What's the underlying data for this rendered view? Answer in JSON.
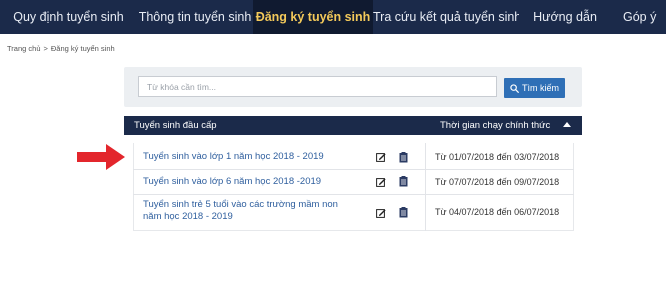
{
  "nav": {
    "items": [
      {
        "label": "Quy định tuyển sinh",
        "active": false
      },
      {
        "label": "Thông tin tuyển sinh",
        "active": false
      },
      {
        "label": "Đăng ký tuyển sinh",
        "active": true
      },
      {
        "label": "Tra cứu kết quả tuyển sinh",
        "active": false
      },
      {
        "label": "Hướng dẫn",
        "active": false
      },
      {
        "label": "Góp ý",
        "active": false
      }
    ]
  },
  "breadcrumb": {
    "home": "Trang chủ",
    "separator": ">",
    "current": "Đăng ký tuyển sinh"
  },
  "search": {
    "placeholder": "Từ khóa cần tìm...",
    "value": "",
    "button_label": "Tìm kiếm"
  },
  "table": {
    "header": {
      "name_col": "Tuyển sinh đầu cấp",
      "time_col": "Thời gian chạy chính thức"
    },
    "rows": [
      {
        "name": "Tuyển sinh vào lớp 1 năm học 2018 - 2019",
        "time": "Từ 01/07/2018 đến 03/07/2018"
      },
      {
        "name": "Tuyển sinh vào lớp 6 năm học 2018 -2019",
        "time": "Từ 07/07/2018 đến 09/07/2018"
      },
      {
        "name": "Tuyển sinh trẻ 5 tuổi vào các trường mầm non năm học 2018 - 2019",
        "time": "Từ 04/07/2018 đến 06/07/2018"
      }
    ]
  },
  "colors": {
    "nav_bg": "#1b2a4a",
    "nav_active_text": "#f3c95a",
    "link": "#2f5f9e",
    "button": "#2f6fb6",
    "arrow": "#e3262c"
  },
  "icons": {
    "edit": "edit-icon",
    "document": "document-icon",
    "search": "search-icon",
    "arrow": "red-arrow-pointer"
  }
}
